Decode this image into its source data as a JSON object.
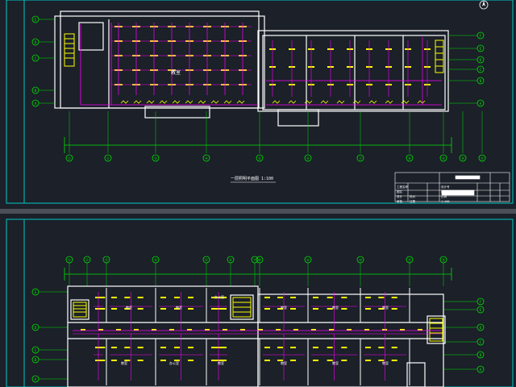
{
  "colors": {
    "background": "#1b2029",
    "frame": "#00c8c8",
    "walls": "#ffffff",
    "grid": "#00e000",
    "wiring": "#ff00ff",
    "fixtures": "#ffff00",
    "text": "#ffffff"
  },
  "sheet_top": {
    "axis_labels": [
      "①",
      "②",
      "③",
      "④",
      "⑤",
      "⑥",
      "⑦",
      "⑧",
      "⑨",
      "⑩",
      "⑪"
    ],
    "row_labels_left": [
      "E",
      "D",
      "C",
      "B",
      "A"
    ],
    "row_labels_right": [
      "F",
      "E",
      "D",
      "C",
      "B",
      "A"
    ],
    "room_label": "教室",
    "scale_title": "一层照明平面图  1:100",
    "title_block": {
      "rows": [
        [
          "工程名称",
          "",
          "设计号"
        ],
        [
          "图名",
          "",
          "图号"
        ],
        [
          "设计",
          "校对",
          "比例"
        ],
        [
          "审核",
          "日期",
          "1:100"
        ]
      ]
    }
  },
  "sheet_bottom": {
    "axis_labels": [
      "①",
      "②",
      "③",
      "④",
      "⑤",
      "⑥",
      "⑦",
      "⑧",
      "⑨",
      "⑩",
      "⑪",
      "⑫"
    ],
    "row_labels_left": [
      "E",
      "D",
      "C",
      "B",
      "A"
    ],
    "row_labels_right": [
      "F",
      "E",
      "D",
      "C",
      "B",
      "A"
    ],
    "room_labels": [
      "教室",
      "教室",
      "办公室",
      "教室",
      "教室",
      "教室",
      "教室",
      "办公室",
      "教室",
      "教室",
      "教室",
      "教室"
    ]
  }
}
